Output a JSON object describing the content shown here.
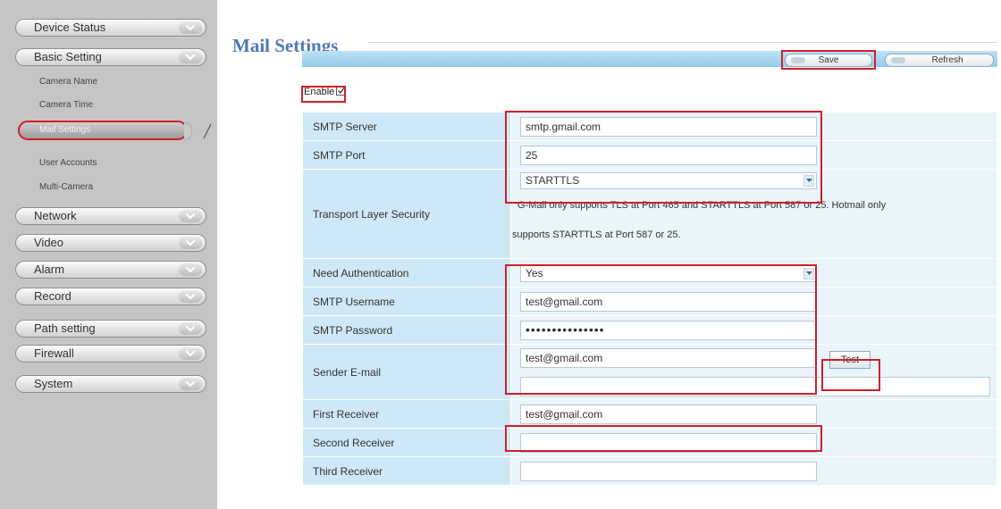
{
  "sidebar": {
    "menus": [
      {
        "label": "Device Status"
      },
      {
        "label": "Basic Setting"
      },
      {
        "label": "Network"
      },
      {
        "label": "Video"
      },
      {
        "label": "Alarm"
      },
      {
        "label": "Record"
      },
      {
        "label": "Path setting"
      },
      {
        "label": "Firewall"
      },
      {
        "label": "System"
      }
    ],
    "basic_sub": [
      "Camera Name",
      "Camera Time",
      "Mail Settings",
      "User Accounts",
      "Multi-Camera"
    ]
  },
  "page": {
    "title": "Mail Settings",
    "save_label": "Save",
    "refresh_label": "Refresh",
    "enable_label": "Enable",
    "enable_checked": true
  },
  "form": {
    "smtp_server": {
      "label": "SMTP Server",
      "value": "smtp.gmail.com"
    },
    "smtp_port": {
      "label": "SMTP Port",
      "value": "25"
    },
    "tls": {
      "label": "Transport Layer Security",
      "value": "STARTTLS",
      "note_line1": "G-Mail only supports TLS at Port 465 and STARTTLS at Port 587 or 25. Hotmail only",
      "note_line2": "supports STARTTLS at Port 587 or 25."
    },
    "need_auth": {
      "label": "Need Authentication",
      "value": "Yes"
    },
    "smtp_username": {
      "label": "SMTP Username",
      "value": "test@gmail.com"
    },
    "smtp_password": {
      "label": "SMTP Password",
      "value": "•••••••••••••••"
    },
    "sender_email": {
      "label": "Sender E-mail",
      "value": "test@gmail.com",
      "test_label": "Test"
    },
    "first_receiver": {
      "label": "First Receiver",
      "value": "test@gmail.com"
    },
    "second_receiver": {
      "label": "Second Receiver",
      "value": ""
    },
    "third_receiver": {
      "label": "Third Receiver",
      "value": ""
    }
  },
  "colors": {
    "title_blue": "#4f79b6",
    "highlight_red": "#d21e2a",
    "label_cell": "#cfe8f7",
    "value_cell": "#e9f4fb"
  }
}
